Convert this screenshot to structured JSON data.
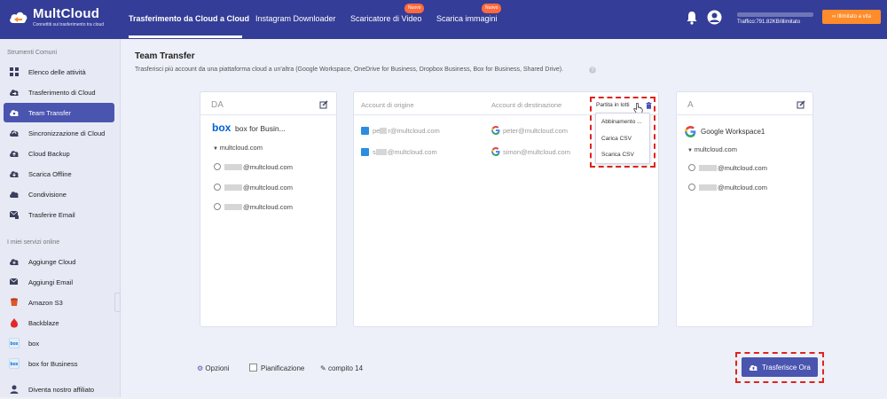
{
  "app": {
    "name": "MultCloud",
    "slogan": "Connettiti sui trasferimento tra cloud"
  },
  "nav": {
    "tabs": [
      {
        "label": "Trasferimento da Cloud a Cloud",
        "active": true
      },
      {
        "label": "Instagram Downloader"
      },
      {
        "label": "Scaricatore di Video",
        "badge": "Nuovo"
      },
      {
        "label": "Scarica immagini",
        "badge": "Nuovo"
      }
    ],
    "traffic": "Traffico:791.82KB/illimitato",
    "upgrade": "Illimitato a vita"
  },
  "sidebar": {
    "section1": "Strumenti Comuni",
    "section2": "I miei servizi online",
    "common": [
      {
        "label": "Elenco delle attività",
        "icon": "grid-icon"
      },
      {
        "label": "Trasferimento di Cloud",
        "icon": "cloud-transfer-icon"
      },
      {
        "label": "Team Transfer",
        "icon": "team-transfer-icon",
        "active": true
      },
      {
        "label": "Sincronizzazione di Cloud",
        "icon": "cloud-sync-icon"
      },
      {
        "label": "Cloud Backup",
        "icon": "cloud-backup-icon"
      },
      {
        "label": "Scarica Offline",
        "icon": "cloud-download-icon"
      },
      {
        "label": "Condivisione",
        "icon": "share-icon"
      },
      {
        "label": "Trasferire Email",
        "icon": "email-transfer-icon"
      }
    ],
    "services": [
      {
        "label": "Aggiunge Cloud",
        "icon": "add-cloud-icon"
      },
      {
        "label": "Aggiungi Email",
        "icon": "add-email-icon"
      },
      {
        "label": "Amazon S3",
        "icon": "amazon-s3-icon"
      },
      {
        "label": "Backblaze",
        "icon": "backblaze-icon"
      },
      {
        "label": "box",
        "icon": "box-icon"
      },
      {
        "label": "box for Business",
        "icon": "box-business-icon"
      },
      {
        "label": "Diventa nostro affiliato",
        "icon": "affiliate-icon"
      }
    ]
  },
  "main": {
    "title": "Team Transfer",
    "description": "Trasferisci più account da una piattaforma cloud a un'altra (Google Workspace, OneDrive for Business, Dropbox Business, Box for Business, Shared Drive)."
  },
  "from_panel": {
    "title": "DA",
    "service_logo": "box",
    "service_name": "box for Busin...",
    "domain": "multcloud.com",
    "accounts": [
      "@multcloud.com",
      "@multcloud.com",
      "@multcloud.com"
    ]
  },
  "mapping_panel": {
    "col_source": "Account di origine",
    "col_dest": "Account di destinazione",
    "batch_label": "Partita in lotti",
    "batch_menu": [
      "Abbinamento ...",
      "Carica CSV",
      "Scarica CSV"
    ],
    "rows": [
      {
        "source_prefix": "pe",
        "source_rest": "r@multcloud.com",
        "dest": "peter@multcloud.com"
      },
      {
        "source_prefix": "s",
        "source_rest": "@multcloud.com",
        "dest": "simon@multcloud.com"
      }
    ]
  },
  "to_panel": {
    "title": "A",
    "service_name": "Google Workspace1",
    "domain": "multcloud.com",
    "accounts": [
      "@multcloud.com",
      "@multcloud.com"
    ]
  },
  "bottom": {
    "options": "Opzioni",
    "schedule": "Pianificazione",
    "task_name": "compito 14",
    "transfer_button": "Trasferisce Ora"
  },
  "colors": {
    "topbar": "#343d97",
    "accent": "#4a55b0",
    "badge": "#ff6a3d",
    "upgrade": "#ff8c2a",
    "highlight": "#e0231e"
  }
}
